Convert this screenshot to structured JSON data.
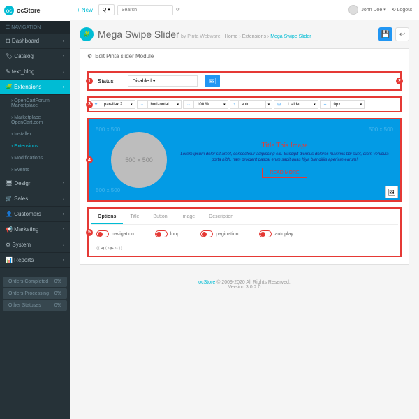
{
  "logo": {
    "text": "ocStore"
  },
  "topbar": {
    "new": "+ New",
    "search_dd": "Q ▾",
    "search_placeholder": "Search",
    "user": "John Doe ▾",
    "logout": "⟲ Logout"
  },
  "nav": {
    "header": "☰ NAVIGATION",
    "items": [
      {
        "label": "Dashboard",
        "ico": "⊞"
      },
      {
        "label": "Catalog",
        "ico": "🏷"
      },
      {
        "label": "text_blog",
        "ico": "✎"
      },
      {
        "label": "Extensions",
        "ico": "🧩",
        "active": true
      },
      {
        "label": "Design",
        "ico": "🖥"
      },
      {
        "label": "Sales",
        "ico": "🛒"
      },
      {
        "label": "Customers",
        "ico": "👤"
      },
      {
        "label": "Marketing",
        "ico": "📢"
      },
      {
        "label": "System",
        "ico": "⚙"
      },
      {
        "label": "Reports",
        "ico": "📊"
      }
    ],
    "subs": [
      {
        "label": "OpenCartForum Marketplace"
      },
      {
        "label": "Marketplace OpenCart.com"
      },
      {
        "label": "Installer"
      },
      {
        "label": "Extensions",
        "active": true
      },
      {
        "label": "Modifications"
      },
      {
        "label": "Events"
      }
    ],
    "stats": [
      {
        "label": "Orders Completed",
        "val": "0%"
      },
      {
        "label": "Orders Processing",
        "val": "0%"
      },
      {
        "label": "Other Statuses",
        "val": "0%"
      }
    ]
  },
  "page": {
    "title": "Mega Swipe Slider",
    "sub": "by Pinta Webware",
    "crumb_home": "Home",
    "crumb_ext": "Extensions",
    "crumb_cur": "Mega Swipe Slider",
    "panel_title": "Edit Pinta slider Module"
  },
  "status": {
    "label": "Status",
    "value": "Disabled"
  },
  "markers": {
    "m1": "1",
    "m2": "2",
    "m3": "3",
    "m4": "4",
    "m5": "5"
  },
  "options": [
    {
      "ico": "✦",
      "val": "parallax 2"
    },
    {
      "ico": "↔",
      "val": "horizontal"
    },
    {
      "ico": "↔",
      "val": "100 %"
    },
    {
      "ico": "↕",
      "val": "auto"
    },
    {
      "ico": "⊞",
      "val": "1 slide"
    },
    {
      "ico": "⇔",
      "val": "0px"
    }
  ],
  "slide": {
    "circle": "500 x 500",
    "title": "Title This Image",
    "text": "Lorem ipsum dolor sit amet, consectetur adipiscing elit. Suscipit dicimus dolores maximis tibi sunt, diam vehicula porta nibh, nam proident pascal enim sapit quas hiya blanditiis aperiam earum!",
    "btn": "READ MORE"
  },
  "tabs": {
    "items": [
      "Options",
      "Title",
      "Button",
      "Image",
      "Description"
    ],
    "active": 0,
    "toggles": [
      {
        "label": "navigation"
      },
      {
        "label": "loop"
      },
      {
        "label": "pagination"
      },
      {
        "label": "autoplay"
      }
    ]
  },
  "footer": {
    "link": "ocStore",
    "text": "© 2009-2020 All Rights Reserved.",
    "version": "Version 3.0.2.0"
  }
}
